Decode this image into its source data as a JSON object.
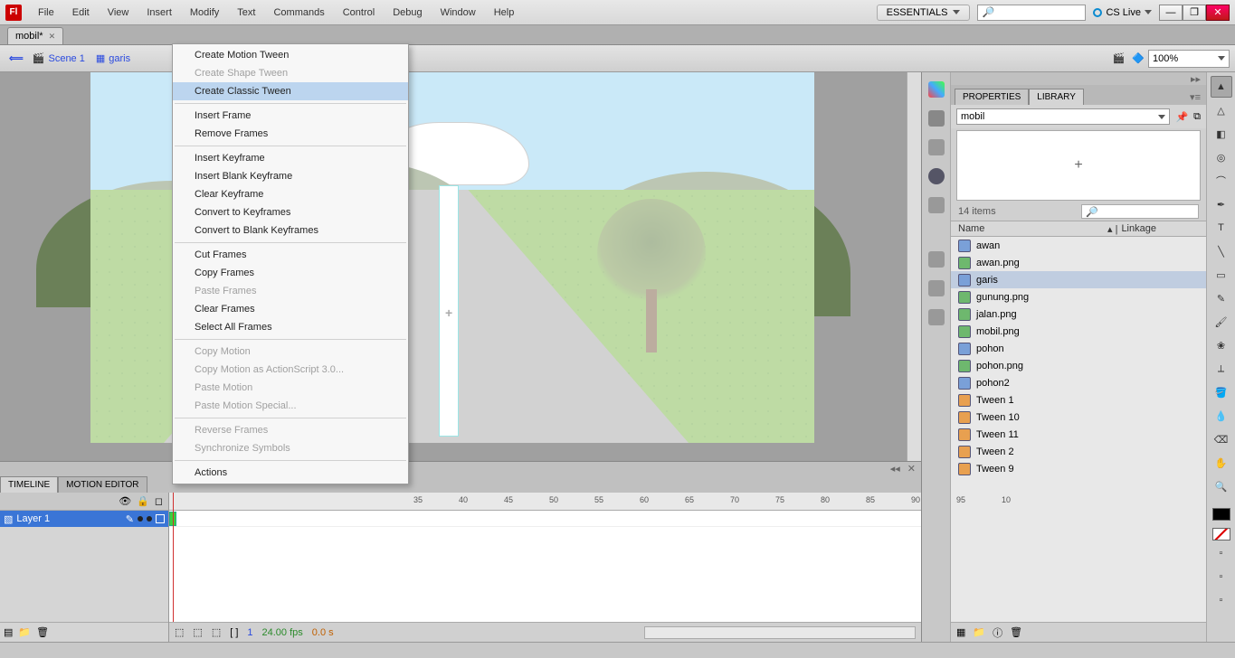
{
  "menu": {
    "items": [
      "File",
      "Edit",
      "View",
      "Insert",
      "Modify",
      "Text",
      "Commands",
      "Control",
      "Debug",
      "Window",
      "Help"
    ]
  },
  "workspace": "ESSENTIALS",
  "cslive": "CS Live",
  "doc_tab": "mobil*",
  "topsearch_icon": "🔎",
  "breadcrumb": {
    "back": "⟸",
    "scene": "Scene 1",
    "symbol": "garis"
  },
  "zoom": "100%",
  "context_menu": {
    "groups": [
      [
        {
          "label": "Create Motion Tween",
          "enabled": true
        },
        {
          "label": "Create Shape Tween",
          "enabled": false
        },
        {
          "label": "Create Classic Tween",
          "enabled": true,
          "highlight": true
        }
      ],
      [
        {
          "label": "Insert Frame",
          "enabled": true
        },
        {
          "label": "Remove Frames",
          "enabled": true
        }
      ],
      [
        {
          "label": "Insert Keyframe",
          "enabled": true
        },
        {
          "label": "Insert Blank Keyframe",
          "enabled": true
        },
        {
          "label": "Clear Keyframe",
          "enabled": true
        },
        {
          "label": "Convert to Keyframes",
          "enabled": true
        },
        {
          "label": "Convert to Blank Keyframes",
          "enabled": true
        }
      ],
      [
        {
          "label": "Cut Frames",
          "enabled": true
        },
        {
          "label": "Copy Frames",
          "enabled": true
        },
        {
          "label": "Paste Frames",
          "enabled": false
        },
        {
          "label": "Clear Frames",
          "enabled": true
        },
        {
          "label": "Select All Frames",
          "enabled": true
        }
      ],
      [
        {
          "label": "Copy Motion",
          "enabled": false
        },
        {
          "label": "Copy Motion as ActionScript 3.0...",
          "enabled": false
        },
        {
          "label": "Paste Motion",
          "enabled": false
        },
        {
          "label": "Paste Motion Special...",
          "enabled": false
        }
      ],
      [
        {
          "label": "Reverse Frames",
          "enabled": false
        },
        {
          "label": "Synchronize Symbols",
          "enabled": false
        }
      ],
      [
        {
          "label": "Actions",
          "enabled": true
        }
      ]
    ]
  },
  "timeline": {
    "tabs": [
      "TIMELINE",
      "MOTION EDITOR"
    ],
    "layer": "Layer 1",
    "ruler_ticks": [
      35,
      40,
      45,
      50,
      55,
      60,
      65,
      70,
      75,
      80,
      85,
      90,
      95,
      "10"
    ],
    "fps": "24.00 fps",
    "time": "0.0 s",
    "frame": "1"
  },
  "library": {
    "tabs": [
      "PROPERTIES",
      "LIBRARY"
    ],
    "doc": "mobil",
    "count": "14 items",
    "cols": [
      "Name",
      "Linkage"
    ],
    "items": [
      {
        "name": "awan",
        "type": "mc"
      },
      {
        "name": "awan.png",
        "type": "bmp"
      },
      {
        "name": "garis",
        "type": "mc",
        "sel": true
      },
      {
        "name": "gunung.png",
        "type": "bmp"
      },
      {
        "name": "jalan.png",
        "type": "bmp"
      },
      {
        "name": "mobil.png",
        "type": "bmp"
      },
      {
        "name": "pohon",
        "type": "mc"
      },
      {
        "name": "pohon.png",
        "type": "bmp"
      },
      {
        "name": "pohon2",
        "type": "mc"
      },
      {
        "name": "Tween 1",
        "type": "gfx"
      },
      {
        "name": "Tween 10",
        "type": "gfx"
      },
      {
        "name": "Tween 11",
        "type": "gfx"
      },
      {
        "name": "Tween 2",
        "type": "gfx"
      },
      {
        "name": "Tween 9",
        "type": "gfx"
      }
    ]
  },
  "toolbox_tools": [
    "selection",
    "subselect",
    "free-transform",
    "3d-rotate",
    "lasso",
    "pen",
    "text",
    "line",
    "rect",
    "pencil",
    "brush",
    "deco",
    "bone",
    "paint-bucket",
    "eyedropper",
    "eraser",
    "hand",
    "zoom"
  ],
  "colors": {
    "stroke": "#000000",
    "fill": "#d43b3b"
  }
}
